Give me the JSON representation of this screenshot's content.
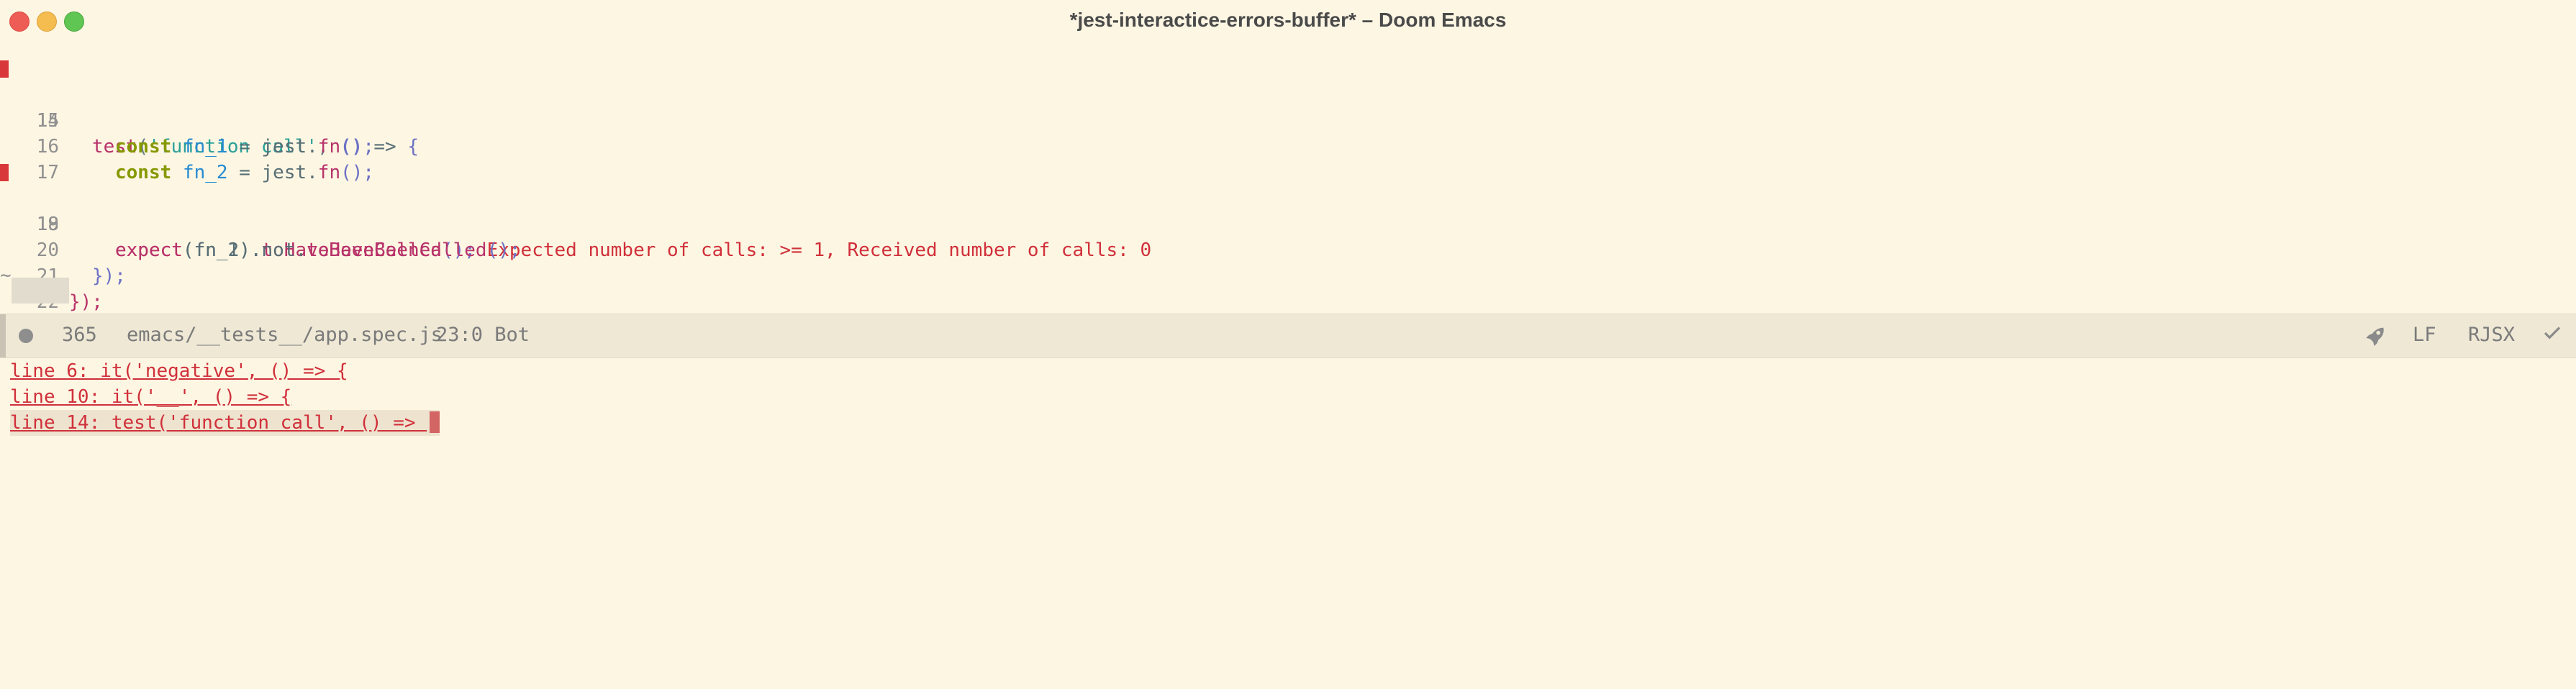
{
  "window": {
    "title": "*jest-interactice-errors-buffer* – Doom Emacs"
  },
  "editor": {
    "lines": [
      {
        "num": "14",
        "parts": [
          "test",
          "(",
          "'function call'",
          ", ",
          "()",
          " => ",
          "{"
        ],
        "error_mark": true
      },
      {
        "num": "15",
        "parts": [
          "const",
          " ",
          "fn_1",
          " = jest.",
          "fn",
          "();"
        ]
      },
      {
        "num": "16",
        "parts": [
          "const",
          " ",
          "fn_2",
          " = jest.",
          "fn",
          "();"
        ]
      },
      {
        "num": "17",
        "parts": []
      },
      {
        "num": "18",
        "parts": [
          "expect",
          "(fn_1).",
          "toHaveBeenCalled",
          "();",
          " Expected number of calls: >= 1, Received number of calls: 0"
        ],
        "error_mark": true
      },
      {
        "num": "19",
        "parts": [
          "expect",
          "(fn_2).not.",
          "toHaveBeenCalled",
          "();"
        ]
      },
      {
        "num": "20",
        "parts": [
          "});"
        ]
      },
      {
        "num": "21",
        "parts": [
          "});"
        ]
      },
      {
        "num": "22",
        "parts": []
      }
    ],
    "tilde": "~"
  },
  "modeline": {
    "size": "365",
    "path": "emacs/__tests__/app.spec.js",
    "position": "23:0 Bot",
    "eol": "LF",
    "mode": "RJSX",
    "rocket_icon": "rocket-icon",
    "check_icon": "check-icon"
  },
  "results": [
    {
      "text": "line 6: it('negative', () => {"
    },
    {
      "text": "line 10: it('__', () => {"
    },
    {
      "text": "line 14: test('function call', () => "
    }
  ]
}
